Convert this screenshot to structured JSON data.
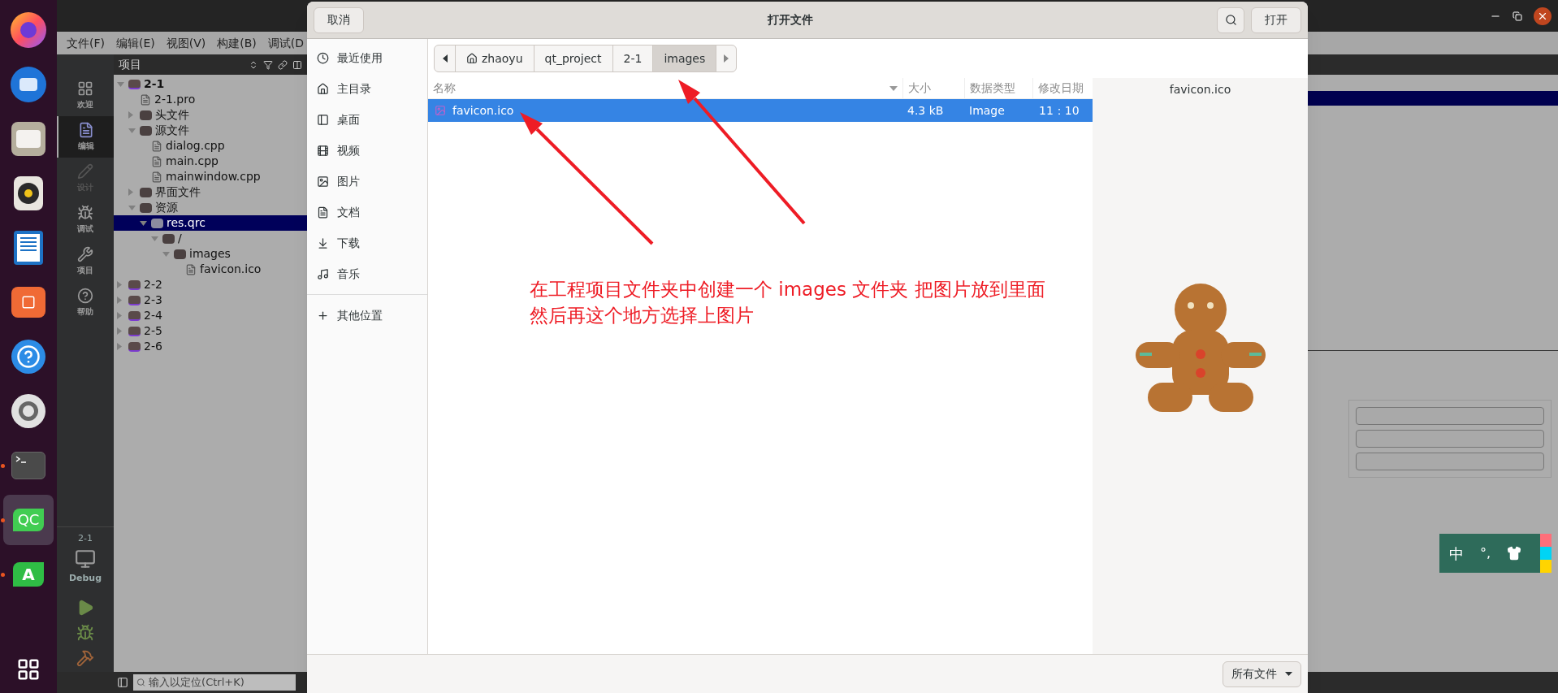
{
  "dock": {
    "apps": [
      {
        "kind": "browser",
        "running": false,
        "selected": false
      },
      {
        "kind": "mail",
        "running": false,
        "selected": false
      },
      {
        "kind": "files",
        "running": false,
        "selected": false
      },
      {
        "kind": "speaker",
        "running": false,
        "selected": false
      },
      {
        "kind": "writer",
        "running": false,
        "selected": false
      },
      {
        "kind": "store",
        "running": false,
        "selected": false
      },
      {
        "kind": "help",
        "running": false,
        "selected": false
      },
      {
        "kind": "settings",
        "running": false,
        "selected": false
      },
      {
        "kind": "terminal",
        "running": true,
        "selected": false
      },
      {
        "kind": "qtcreator",
        "label": "QC",
        "running": true,
        "selected": true
      },
      {
        "kind": "assistant",
        "label": "A",
        "running": true,
        "selected": false
      }
    ]
  },
  "qt_window": {
    "menu": [
      "文件(F)",
      "编辑(E)",
      "视图(V)",
      "构建(B)",
      "调试(D"
    ],
    "modes": [
      {
        "kind": "welcome",
        "label": "欢迎",
        "selected": false,
        "disabled": false
      },
      {
        "kind": "edit",
        "label": "编辑",
        "selected": true,
        "disabled": false
      },
      {
        "kind": "design",
        "label": "设计",
        "selected": false,
        "disabled": true
      },
      {
        "kind": "debug",
        "label": "调试",
        "selected": false,
        "disabled": false
      },
      {
        "kind": "projects",
        "label": "项目",
        "selected": false,
        "disabled": false
      },
      {
        "kind": "help",
        "label": "帮助",
        "selected": false,
        "disabled": false
      }
    ],
    "kit": {
      "project": "2-1",
      "build": "Debug"
    },
    "project_panel": {
      "title": "项目",
      "tree": [
        {
          "kind": "project",
          "label": "2-1",
          "expanded": true,
          "selected": false,
          "children": [
            {
              "kind": "pro",
              "label": "2-1.pro",
              "selected": false
            },
            {
              "kind": "headers",
              "label": "头文件",
              "expanded": false,
              "selected": false
            },
            {
              "kind": "sources",
              "label": "源文件",
              "expanded": true,
              "selected": false,
              "children": [
                {
                  "kind": "cpp",
                  "label": "dialog.cpp",
                  "selected": false
                },
                {
                  "kind": "cpp",
                  "label": "main.cpp",
                  "selected": false
                },
                {
                  "kind": "cpp",
                  "label": "mainwindow.cpp",
                  "selected": false
                }
              ]
            },
            {
              "kind": "forms",
              "label": "界面文件",
              "expanded": false,
              "selected": false
            },
            {
              "kind": "resources",
              "label": "资源",
              "expanded": true,
              "selected": false,
              "children": [
                {
                  "kind": "qrc",
                  "label": "res.qrc",
                  "expanded": true,
                  "selected": true,
                  "children": [
                    {
                      "kind": "folder",
                      "label": "/",
                      "expanded": true,
                      "selected": false,
                      "children": [
                        {
                          "kind": "folder",
                          "label": "images",
                          "expanded": true,
                          "selected": false,
                          "children": [
                            {
                              "kind": "file",
                              "label": "favicon.ico",
                              "selected": false
                            }
                          ]
                        }
                      ]
                    }
                  ]
                }
              ]
            }
          ]
        },
        {
          "kind": "project",
          "label": "2-2",
          "expanded": false,
          "selected": false
        },
        {
          "kind": "project",
          "label": "2-3",
          "expanded": false,
          "selected": false
        },
        {
          "kind": "project",
          "label": "2-4",
          "expanded": false,
          "selected": false
        },
        {
          "kind": "project",
          "label": "2-5",
          "expanded": false,
          "selected": false
        },
        {
          "kind": "project",
          "label": "2-6",
          "expanded": false,
          "selected": false
        }
      ]
    },
    "locator": {
      "placeholder": "输入以定位(Ctrl+K)"
    }
  },
  "dialog": {
    "title": "打开文件",
    "cancel": "取消",
    "open": "打开",
    "places": [
      {
        "kind": "recent",
        "label": "最近使用"
      },
      {
        "kind": "home",
        "label": "主目录"
      },
      {
        "kind": "desktop",
        "label": "桌面"
      },
      {
        "kind": "videos",
        "label": "视频"
      },
      {
        "kind": "pictures",
        "label": "图片"
      },
      {
        "kind": "documents",
        "label": "文档"
      },
      {
        "kind": "downloads",
        "label": "下载"
      },
      {
        "kind": "music",
        "label": "音乐"
      },
      {
        "kind": "other",
        "label": "其他位置"
      }
    ],
    "path": [
      {
        "label": "zhaoyu",
        "home": true,
        "selected": false
      },
      {
        "label": "qt_project",
        "home": false,
        "selected": false
      },
      {
        "label": "2-1",
        "home": false,
        "selected": false
      },
      {
        "label": "images",
        "home": false,
        "selected": true
      }
    ],
    "columns": [
      "名称",
      "大小",
      "数据类型",
      "修改日期"
    ],
    "rows": [
      {
        "name": "favicon.ico",
        "size": "4.3 kB",
        "type": "Image",
        "modified": "11：10",
        "selected": true
      }
    ],
    "preview": {
      "name": "favicon.ico"
    },
    "filter": "所有文件"
  },
  "annotation": {
    "lines": [
      "在工程项目文件夹中创建一个 images 文件夹 把图片放到里面",
      "然后再这个地方选择上图片"
    ]
  },
  "input_method": {
    "mode": "中",
    "punctuation": "°,"
  }
}
